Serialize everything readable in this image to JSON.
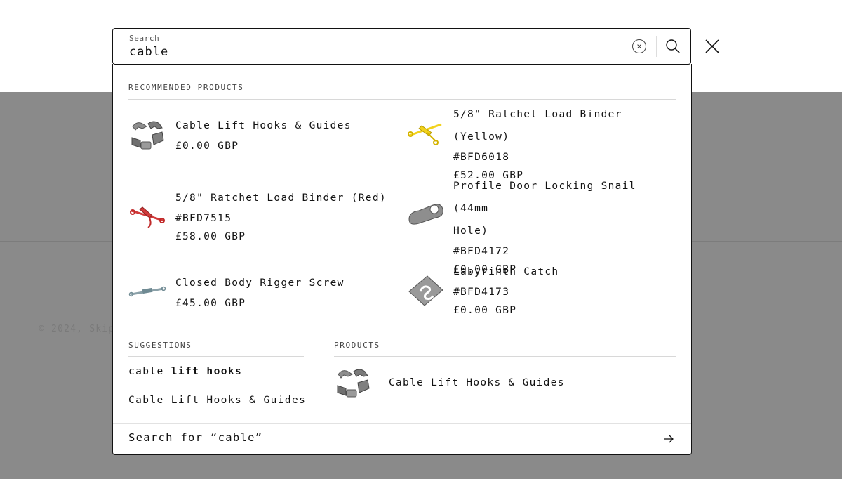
{
  "background": {
    "copyright": "© 2024, Skip"
  },
  "search": {
    "label": "Search",
    "value": "cable",
    "clear_glyph": "×"
  },
  "recommended": {
    "heading": "Recommended products",
    "items": [
      {
        "title": "Cable Lift Hooks & Guides",
        "sku": "",
        "price": "£0.00 GBP",
        "thumb": "grey-hooks"
      },
      {
        "title": "5/8\" Ratchet Load Binder (Yellow)",
        "sku": "#BFD6018",
        "price": "£52.00 GBP",
        "thumb": "yellow-binder"
      },
      {
        "title": "5/8\" Ratchet Load Binder (Red)",
        "sku": "#BFD7515",
        "price": "£58.00 GBP",
        "thumb": "red-binder"
      },
      {
        "title_line1": "Profile Door Locking Snail (44mm",
        "title_line2": "Hole)",
        "sku": "#BFD4172",
        "price": "£0.00 GBP",
        "thumb": "grey-snail"
      },
      {
        "title": "Closed Body Rigger Screw",
        "sku": "",
        "price": "£45.00 GBP",
        "thumb": "rigger-screw"
      },
      {
        "title": "Labyrinth Catch",
        "sku": "#BFD4173",
        "price": "£0.00 GBP",
        "thumb": "grey-catch"
      }
    ]
  },
  "suggestions": {
    "heading": "Suggestions",
    "items": [
      {
        "prefix": "cable",
        "rest": " lift hooks"
      },
      {
        "prefix": "",
        "rest": "Cable Lift Hooks & Guides"
      }
    ]
  },
  "products": {
    "heading": "Products",
    "items": [
      {
        "title": "Cable Lift Hooks & Guides"
      }
    ]
  },
  "footer": {
    "label": "Search for “cable”"
  },
  "colors": {
    "overlay": "#8a8a8a",
    "text": "#121212",
    "yellow": "#f2d21c",
    "red": "#d23a3a",
    "grey": "#8e8e8e"
  }
}
